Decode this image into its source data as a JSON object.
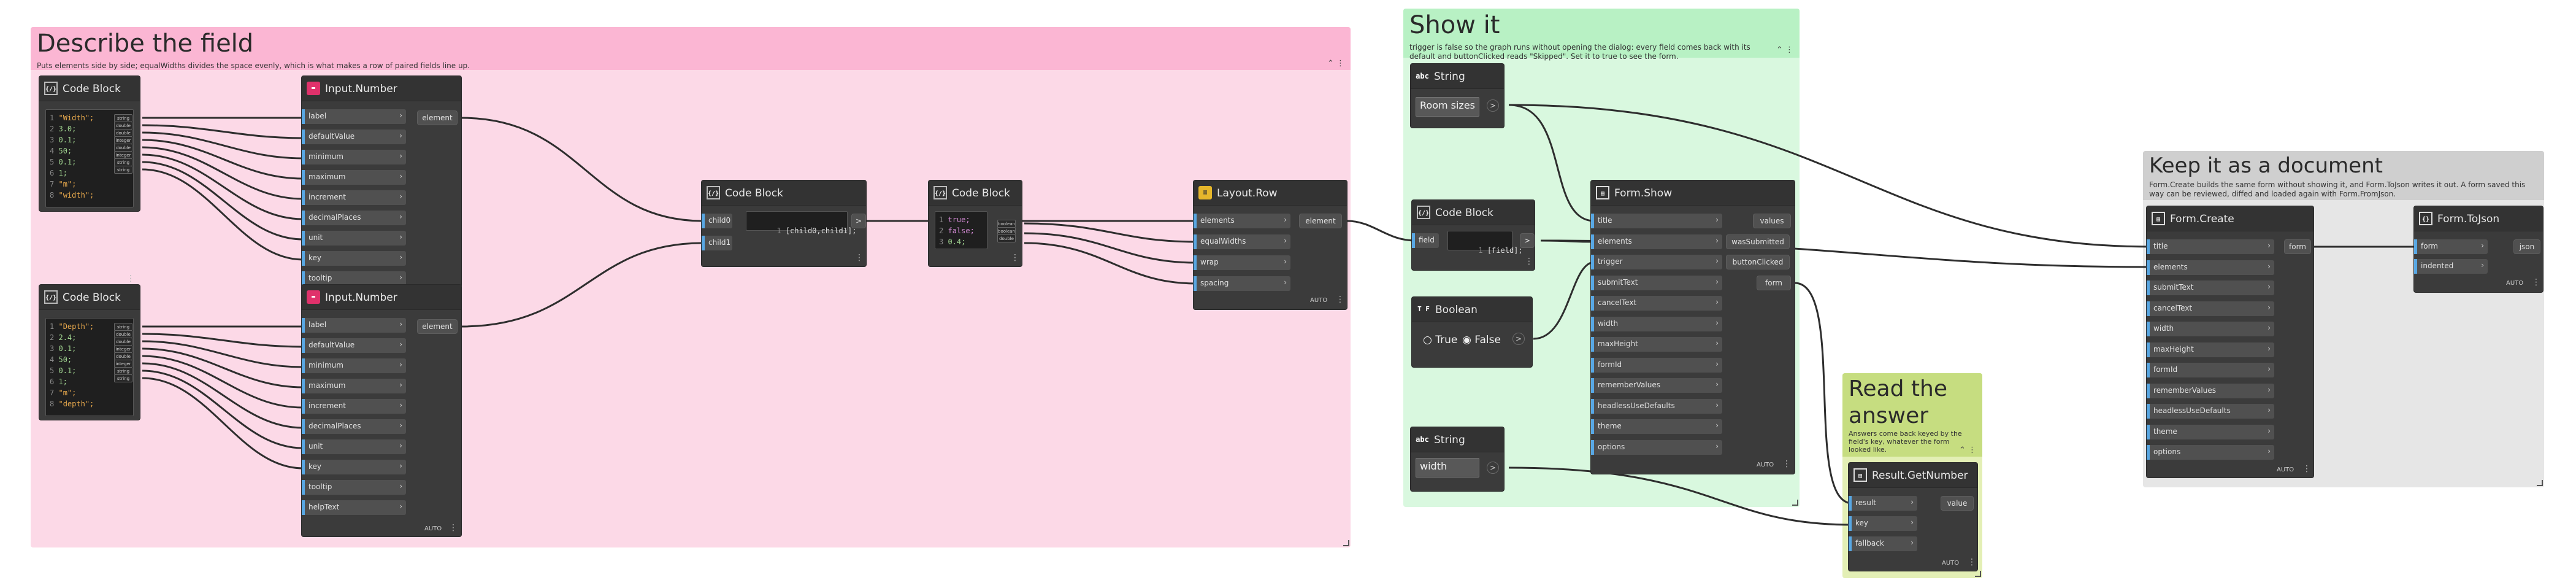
{
  "colors": {
    "group_describe": "#fcd9e7",
    "group_describe_header": "#fbb6d3",
    "group_show": "#d9f8df",
    "group_show_header": "#b8f1c4",
    "group_read": "#e3efb5",
    "group_read_header": "#c6dd80",
    "group_keep": "#e6e6e6",
    "group_keep_header": "#cfcfcf",
    "node_body": "#3b3b3b",
    "port_accent": "#58a7e3",
    "wire": "#2e2e2e"
  },
  "groups": {
    "describe": {
      "title": "Describe the field",
      "description": "Puts elements side by side; equalWidths divides the space evenly, which is what makes a row of paired fields line up."
    },
    "show": {
      "title": "Show it",
      "description": "trigger is false so the graph runs without opening the dialog: every field comes back with its default and buttonClicked reads \"Skipped\". Set it to true to see the form."
    },
    "read": {
      "title": "Read the answer",
      "description": "Answers come back keyed by the field's key, whatever the form looked like."
    },
    "keep": {
      "title": "Keep it as a document",
      "description": "Form.Create builds the same form without showing it, and Form.ToJson writes it out. A form saved this way can be reviewed, diffed and loaded again with Form.FromJson."
    }
  },
  "collapse_glyph": "⌃ ⋮",
  "nodes": {
    "code_width": {
      "title": "Code Block",
      "icon": "{/}",
      "lines": [
        {
          "n": "1",
          "code": "\"Width\";",
          "kind": "str",
          "type": "string"
        },
        {
          "n": "2",
          "code": "3.0;",
          "kind": "num",
          "type": "double"
        },
        {
          "n": "3",
          "code": "0.1;",
          "kind": "num",
          "type": "double"
        },
        {
          "n": "4",
          "code": "50;",
          "kind": "num",
          "type": "integer"
        },
        {
          "n": "5",
          "code": "0.1;",
          "kind": "num",
          "type": "double"
        },
        {
          "n": "6",
          "code": "1;",
          "kind": "num",
          "type": "integer"
        },
        {
          "n": "7",
          "code": "\"m\";",
          "kind": "str",
          "type": "string"
        },
        {
          "n": "8",
          "code": "\"width\";",
          "kind": "str",
          "type": "string"
        }
      ]
    },
    "code_depth": {
      "title": "Code Block",
      "icon": "{/}",
      "lines": [
        {
          "n": "1",
          "code": "\"Depth\";",
          "kind": "str",
          "type": "string"
        },
        {
          "n": "2",
          "code": "2.4;",
          "kind": "num",
          "type": "double"
        },
        {
          "n": "3",
          "code": "0.1;",
          "kind": "num",
          "type": "double"
        },
        {
          "n": "4",
          "code": "50;",
          "kind": "num",
          "type": "integer"
        },
        {
          "n": "5",
          "code": "0.1;",
          "kind": "num",
          "type": "double"
        },
        {
          "n": "6",
          "code": "1;",
          "kind": "num",
          "type": "integer"
        },
        {
          "n": "7",
          "code": "\"m\";",
          "kind": "str",
          "type": "string"
        },
        {
          "n": "8",
          "code": "\"depth\";",
          "kind": "str",
          "type": "string"
        }
      ]
    },
    "input_number_1": {
      "title": "Input.Number",
      "inputs": [
        "label",
        "defaultValue",
        "minimum",
        "maximum",
        "increment",
        "decimalPlaces",
        "unit",
        "key",
        "tooltip"
      ],
      "output": "element"
    },
    "input_number_2": {
      "title": "Input.Number",
      "inputs": [
        "label",
        "defaultValue",
        "minimum",
        "maximum",
        "increment",
        "decimalPlaces",
        "unit",
        "key",
        "tooltip",
        "helpText"
      ],
      "output": "element",
      "footer": "AUTO"
    },
    "code_list": {
      "title": "Code Block",
      "icon": "{/}",
      "inputs": [
        "child0",
        "child1"
      ],
      "code": "[child0,child1];",
      "output": ">"
    },
    "code_bool": {
      "title": "Code Block",
      "icon": "{/}",
      "lines": [
        {
          "n": "1",
          "code": "true;",
          "kind": "kw",
          "type": "boolean"
        },
        {
          "n": "2",
          "code": "false;",
          "kind": "kw",
          "type": "boolean"
        },
        {
          "n": "3",
          "code": "0.4;",
          "kind": "num",
          "type": "double"
        }
      ]
    },
    "layout_row": {
      "title": "Layout.Row",
      "inputs": [
        "elements",
        "equalWidths",
        "wrap",
        "spacing"
      ],
      "output": "element",
      "footer": "AUTO"
    },
    "string_room": {
      "title": "String",
      "value": "Room sizes"
    },
    "code_field": {
      "title": "Code Block",
      "icon": "{/}",
      "inputs": [
        "field"
      ],
      "code": "[field];"
    },
    "boolean": {
      "title": "Boolean",
      "true_label": "True",
      "false_label": "False"
    },
    "string_width": {
      "title": "String",
      "value": "width"
    },
    "form_show": {
      "title": "Form.Show",
      "inputs": [
        "title",
        "elements",
        "trigger",
        "submitText",
        "cancelText",
        "width",
        "maxHeight",
        "formId",
        "rememberValues",
        "headlessUseDefaults",
        "theme",
        "options"
      ],
      "outputs": [
        "values",
        "wasSubmitted",
        "buttonClicked",
        "form"
      ],
      "footer": "AUTO"
    },
    "result_get_number": {
      "title": "Result.GetNumber",
      "inputs": [
        "result",
        "key",
        "fallback"
      ],
      "output": "value",
      "footer": "AUTO"
    },
    "form_create": {
      "title": "Form.Create",
      "inputs": [
        "title",
        "elements",
        "submitText",
        "cancelText",
        "width",
        "maxHeight",
        "formId",
        "rememberValues",
        "headlessUseDefaults",
        "theme",
        "options"
      ],
      "output": "form",
      "footer": "AUTO"
    },
    "form_to_json": {
      "title": "Form.ToJson",
      "inputs": [
        "form",
        "indented"
      ],
      "output": "json",
      "footer": "AUTO"
    }
  }
}
